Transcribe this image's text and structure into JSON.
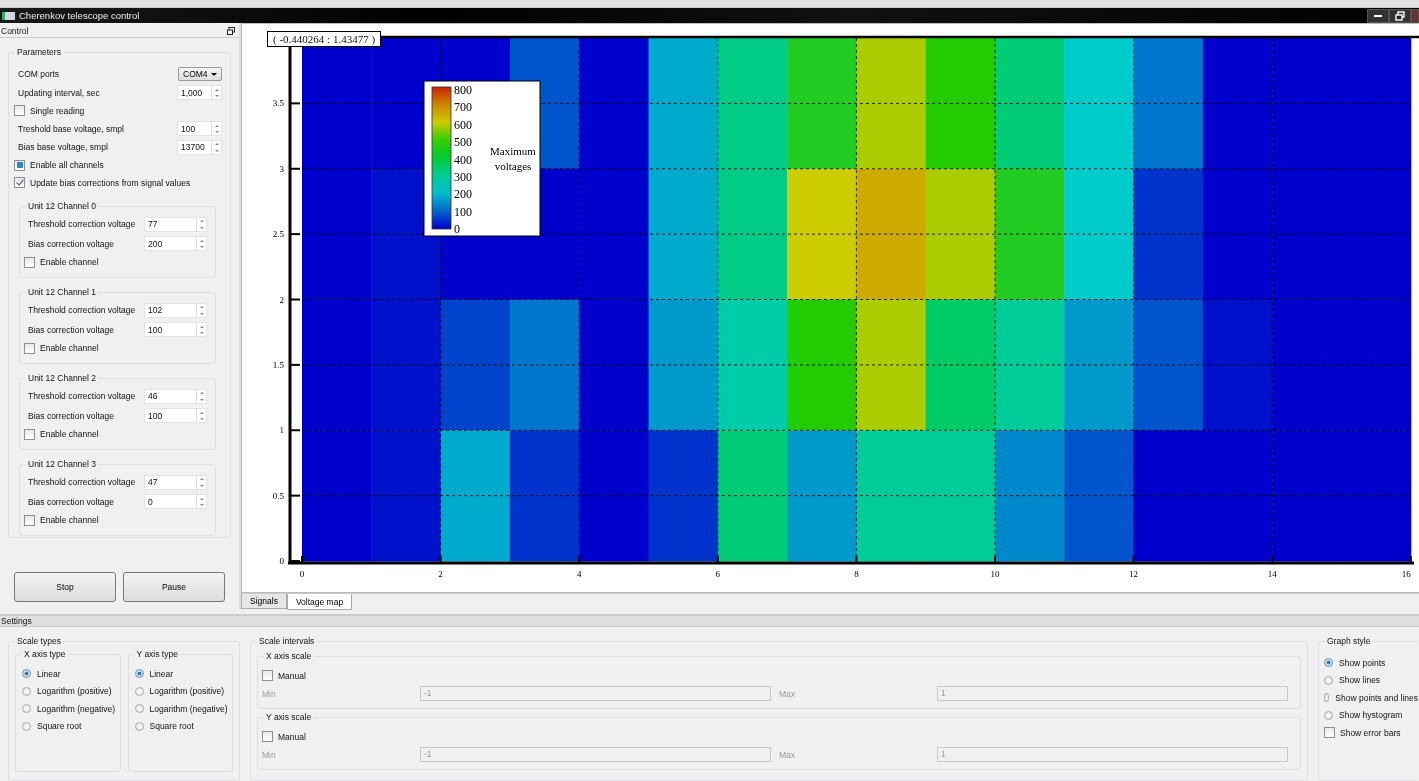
{
  "window": {
    "title": "Cherenkov telescope control"
  },
  "control": {
    "title": "Control",
    "parameters": {
      "title": "Parameters",
      "items": [
        {
          "kind": "combo",
          "label": "COM ports",
          "value": "COM4"
        },
        {
          "kind": "spin",
          "label": "Updating interval, sec",
          "value": "1,000"
        },
        {
          "kind": "check",
          "label": "Single reading",
          "checked": false,
          "partial": false
        },
        {
          "kind": "spin",
          "label": "Treshold base voltage, smpl",
          "value": "100"
        },
        {
          "kind": "spin",
          "label": "Bias base voltage, smpl",
          "value": "13700"
        },
        {
          "kind": "check",
          "label": "Enable all channels",
          "checked": false,
          "partial": true
        },
        {
          "kind": "check",
          "label": "Update bias corrections from signal values",
          "checked": true,
          "partial": false
        }
      ],
      "channels": [
        {
          "title": "Unit 12 Channel 0",
          "threshold": {
            "label": "Threshold correction voltage",
            "value": "77"
          },
          "bias": {
            "label": "Bias correction voltage",
            "value": "200"
          },
          "enable": {
            "label": "Enable channel",
            "checked": false
          }
        },
        {
          "title": "Unit 12 Channel 1",
          "threshold": {
            "label": "Threshold correction voltage",
            "value": "102"
          },
          "bias": {
            "label": "Bias correction voltage",
            "value": "100"
          },
          "enable": {
            "label": "Enable channel",
            "checked": false
          }
        },
        {
          "title": "Unit 12 Channel 2",
          "threshold": {
            "label": "Threshold correction voltage",
            "value": "46"
          },
          "bias": {
            "label": "Bias correction voltage",
            "value": "100"
          },
          "enable": {
            "label": "Enable channel",
            "checked": false
          }
        },
        {
          "title": "Unit 12 Channel 3",
          "threshold": {
            "label": "Threshold correction voltage",
            "value": "47"
          },
          "bias": {
            "label": "Bias correction voltage",
            "value": "0"
          },
          "enable": {
            "label": "Enable channel",
            "checked": false
          }
        }
      ]
    },
    "buttons": [
      "Stop",
      "Pause"
    ]
  },
  "voltage_map": {
    "coordinates": "( -0.440264 : 1.43477 )",
    "rows": [
      {
        "cells": [
          {
            "color": "#0000cc"
          },
          {
            "color": "#0000cc"
          },
          {
            "color": "#0000cc"
          },
          {
            "color": "#0055cc"
          },
          {
            "color": "#0000cc"
          },
          {
            "color": "#00aacc"
          },
          {
            "color": "#00cc88"
          },
          {
            "color": "#22cc22"
          },
          {
            "color": "#aacc00"
          },
          {
            "color": "#22cc00"
          },
          {
            "color": "#00cc77"
          },
          {
            "color": "#00cccc"
          },
          {
            "color": "#0077cc"
          },
          {
            "color": "#0000cc"
          },
          {
            "color": "#0000cc"
          },
          {
            "color": "#0000cc"
          }
        ]
      },
      {
        "cells": [
          {
            "color": "#0000cc"
          },
          {
            "color": "#0011cc"
          },
          {
            "color": "#0000cc"
          },
          {
            "color": "#0000cc"
          },
          {
            "color": "#0000cc"
          },
          {
            "color": "#00aacc"
          },
          {
            "color": "#00cc88"
          },
          {
            "color": "#cccc00"
          },
          {
            "color": "#ccaa00"
          },
          {
            "color": "#aacc00"
          },
          {
            "color": "#22cc22"
          },
          {
            "color": "#00cccc"
          },
          {
            "color": "#0033cc"
          },
          {
            "color": "#0000cc"
          },
          {
            "color": "#0000cc"
          },
          {
            "color": "#0000cc"
          }
        ]
      },
      {
        "cells": [
          {
            "color": "#0000cc"
          },
          {
            "color": "#0011cc"
          },
          {
            "color": "#0044cc"
          },
          {
            "color": "#0077cc"
          },
          {
            "color": "#0000cc"
          },
          {
            "color": "#0099cc"
          },
          {
            "color": "#00ccaa"
          },
          {
            "color": "#22cc00"
          },
          {
            "color": "#aacc00"
          },
          {
            "color": "#00cc66"
          },
          {
            "color": "#00cc99"
          },
          {
            "color": "#0099cc"
          },
          {
            "color": "#0055cc"
          },
          {
            "color": "#0011cc"
          },
          {
            "color": "#0000cc"
          },
          {
            "color": "#0000cc"
          }
        ]
      },
      {
        "cells": [
          {
            "color": "#0000cc"
          },
          {
            "color": "#0011cc"
          },
          {
            "color": "#00aacc"
          },
          {
            "color": "#0033cc"
          },
          {
            "color": "#0000cc"
          },
          {
            "color": "#0033cc"
          },
          {
            "color": "#00cc77"
          },
          {
            "color": "#0099cc"
          },
          {
            "color": "#00cc99"
          },
          {
            "color": "#00cc99"
          },
          {
            "color": "#0088cc"
          },
          {
            "color": "#0055cc"
          },
          {
            "color": "#0000cc"
          },
          {
            "color": "#0000cc"
          },
          {
            "color": "#0000cc"
          },
          {
            "color": "#0000cc"
          }
        ]
      }
    ],
    "xticks": [
      "0",
      "2",
      "4",
      "6",
      "8",
      "10",
      "12",
      "14",
      "16"
    ],
    "yticks": [
      "3.5",
      "3",
      "2.5",
      "2",
      "1.5",
      "1",
      "0.5",
      "0"
    ],
    "legend": {
      "title": [
        "Maximum",
        "voltages"
      ],
      "ticks": [
        "800",
        "700",
        "600",
        "500",
        "400",
        "300",
        "200",
        "100",
        "0"
      ]
    }
  },
  "tabs": [
    {
      "label": "Signals",
      "selected": false
    },
    {
      "label": "Voltage map",
      "selected": true
    }
  ],
  "settings": {
    "title": "Settings",
    "scale_types": {
      "title": "Scale types",
      "groups": [
        {
          "title": "X axis type",
          "options": [
            {
              "label": "Linear",
              "selected": true
            },
            {
              "label": "Logarithm (positive)",
              "selected": false
            },
            {
              "label": "Logarithm (negative)",
              "selected": false
            },
            {
              "label": "Square root",
              "selected": false
            }
          ]
        },
        {
          "title": "Y axis type",
          "options": [
            {
              "label": "Linear",
              "selected": true
            },
            {
              "label": "Logarithm (positive)",
              "selected": false
            },
            {
              "label": "Logarithm (negative)",
              "selected": false
            },
            {
              "label": "Square root",
              "selected": false
            }
          ]
        }
      ]
    },
    "scale_intervals": {
      "title": "Scale intervals",
      "groups": [
        {
          "title": "X axis scale",
          "manual": {
            "label": "Manual",
            "checked": false
          },
          "min": {
            "label": "Min",
            "value": "-1"
          },
          "max": {
            "label": "Max",
            "value": "1"
          }
        },
        {
          "title": "Y axis scale",
          "manual": {
            "label": "Manual",
            "checked": false
          },
          "min": {
            "label": "Min",
            "value": "-1"
          },
          "max": {
            "label": "Max",
            "value": "1"
          }
        }
      ]
    },
    "graph_style": {
      "title": "Graph style",
      "options": [
        {
          "label": "Show points",
          "selected": true
        },
        {
          "label": "Show lines",
          "selected": false
        },
        {
          "label": "Show points and lines",
          "selected": false
        },
        {
          "label": "Show hystogram",
          "selected": false
        }
      ],
      "error_bars": {
        "label": "Show error bars",
        "checked": false
      }
    }
  }
}
